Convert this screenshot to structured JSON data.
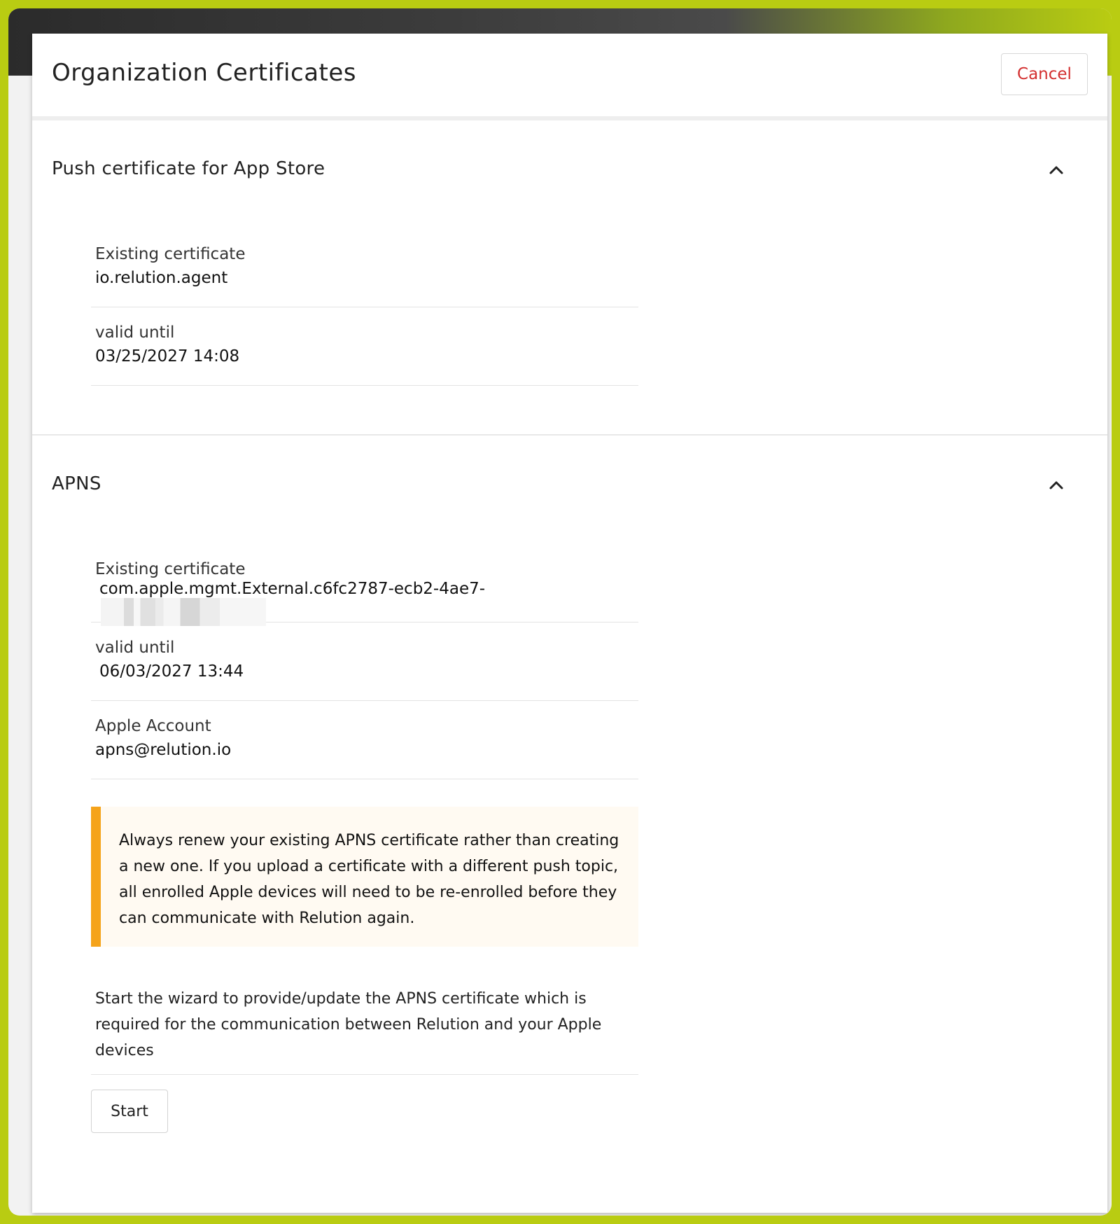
{
  "dialog": {
    "title": "Organization Certificates",
    "cancel_label": "Cancel"
  },
  "push_section": {
    "title": "Push certificate for App Store",
    "fields": [
      {
        "label": "Existing certificate",
        "value": "io.relution.agent"
      },
      {
        "label": "valid until",
        "value": "03/25/2027 14:08"
      }
    ]
  },
  "apns_section": {
    "title": "APNS",
    "fields": [
      {
        "label": "Existing certificate",
        "value": "com.apple.mgmt.External.c6fc2787-ecb2-4ae7-"
      },
      {
        "label": "valid until",
        "value": "06/03/2027 13:44"
      },
      {
        "label": "Apple Account",
        "value": "apns@relution.io"
      }
    ],
    "warning": "Always renew your existing APNS certificate rather than creating a new one. If you upload a certificate with a different push topic, all enrolled Apple devices will need to be re-enrolled before they can communicate with Relution again.",
    "wizard_text": "Start the wizard to provide/update the APNS certificate which is required for the communication between Relution and your Apple devices",
    "start_label": "Start"
  },
  "icons": {
    "collapse": "chevron-up-icon"
  },
  "colors": {
    "accent_frame": "#b9cc12",
    "cancel_text": "#d32f2f",
    "warning_bar": "#f5a31a",
    "warning_bg": "#fffaf2"
  }
}
